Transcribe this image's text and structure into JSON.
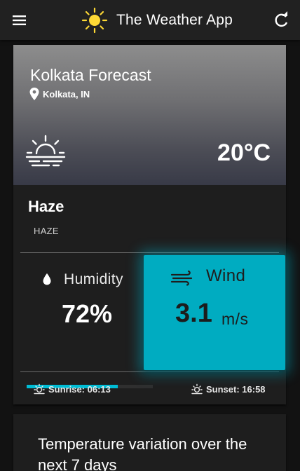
{
  "app": {
    "title": "The Weather App"
  },
  "appbar": {
    "menu_icon": "hamburger-menu-icon",
    "logo_icon": "sun-logo-icon",
    "refresh_icon": "refresh-icon"
  },
  "forecast": {
    "city_title": "Kolkata Forecast",
    "location": "Kolkata, IN",
    "temperature": "20°C",
    "weather_icon": "haze-sun-icon"
  },
  "condition": {
    "main": "Haze",
    "description": "HAZE"
  },
  "humidity": {
    "label": "Humidity",
    "value": "72%",
    "progress_fraction": 0.72
  },
  "wind": {
    "label": "Wind",
    "value": "3.1",
    "unit": "m/s"
  },
  "sun": {
    "sunrise": "Sunrise: 06:13",
    "sunset": "Sunset: 16:58"
  },
  "chart_card": {
    "title": "Temperature variation over the next 7 days"
  },
  "colors": {
    "accent": "#00bcd4",
    "wind_card": "#00acc1",
    "background": "#121212",
    "card": "#1e1e1e",
    "appbar": "#212121",
    "sun_logo": "#fdd835"
  }
}
